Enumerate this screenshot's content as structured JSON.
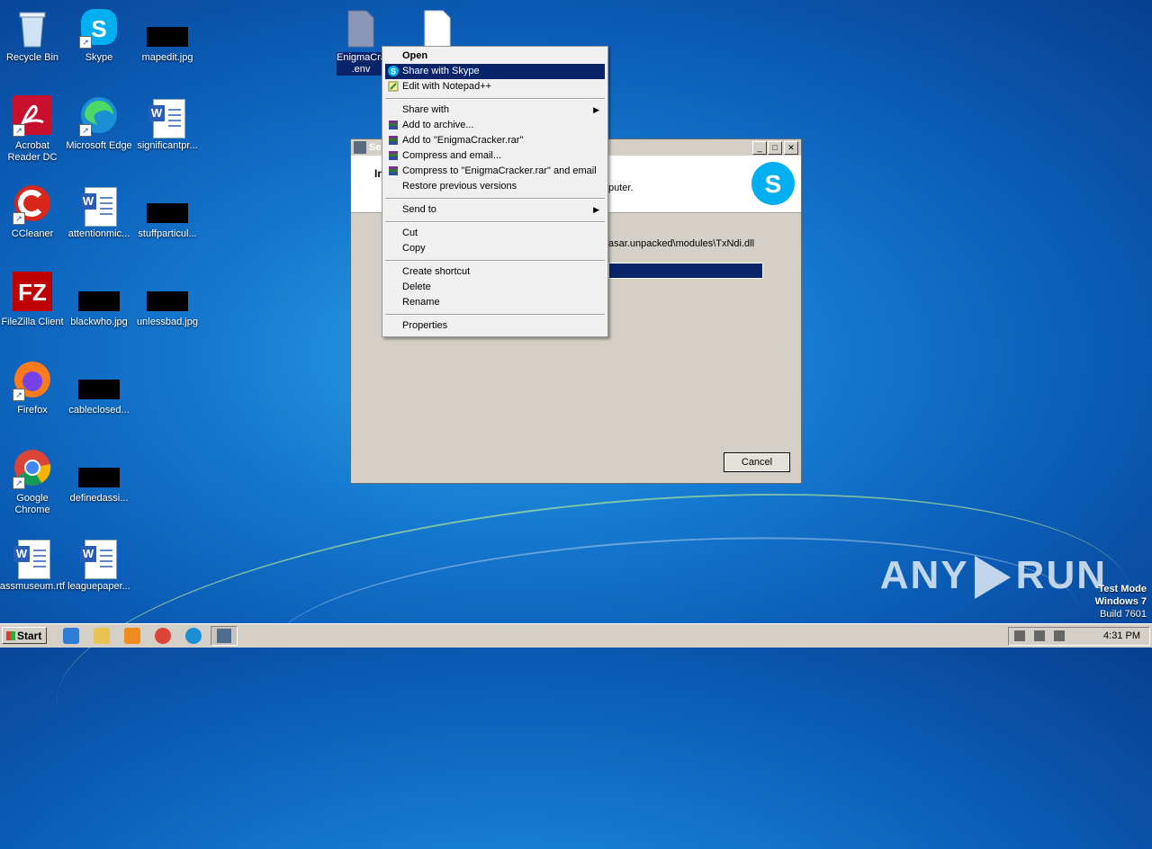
{
  "desktop": {
    "icons": [
      {
        "label": "Recycle Bin"
      },
      {
        "label": "Skype"
      },
      {
        "label": "mapedit.jpg"
      },
      {
        "label": "Acrobat Reader DC"
      },
      {
        "label": "Microsoft Edge"
      },
      {
        "label": "significantpr..."
      },
      {
        "label": "CCleaner"
      },
      {
        "label": "attentionmic..."
      },
      {
        "label": "stuffparticul..."
      },
      {
        "label": "FileZilla Client"
      },
      {
        "label": "blackwho.jpg"
      },
      {
        "label": "unlessbad.jpg"
      },
      {
        "label": "Firefox"
      },
      {
        "label": "cableclosed..."
      },
      {
        "label": "Google Chrome"
      },
      {
        "label": "definedassi..."
      },
      {
        "label": "assmuseum.rtf"
      },
      {
        "label": "leaguepaper..."
      }
    ],
    "selected_file": {
      "label_line1": "EnigmaCra",
      "label_line2": ".env"
    }
  },
  "context_menu": {
    "items": [
      {
        "label": "Open"
      },
      {
        "label": "Share with Skype"
      },
      {
        "label": "Edit with Notepad++"
      },
      {
        "label": "Share with"
      },
      {
        "label": "Add to archive..."
      },
      {
        "label": "Add to \"EnigmaCracker.rar\""
      },
      {
        "label": "Compress and email..."
      },
      {
        "label": "Compress to \"EnigmaCracker.rar\" and email"
      },
      {
        "label": "Restore previous versions"
      },
      {
        "label": "Send to"
      },
      {
        "label": "Cut"
      },
      {
        "label": "Copy"
      },
      {
        "label": "Create shortcut"
      },
      {
        "label": "Delete"
      },
      {
        "label": "Rename"
      },
      {
        "label": "Properties"
      }
    ]
  },
  "dialog": {
    "title_visible": "Se",
    "header_text": "In",
    "header_tail": "puter.",
    "path_text": "asar.unpacked\\modules\\TxNdi.dll",
    "cancel_label": "Cancel"
  },
  "taskbar": {
    "start_label": "Start",
    "clock": "4:31 PM"
  },
  "watermark": {
    "brand_left": "ANY",
    "brand_right": "RUN",
    "mode": "Test Mode",
    "os": "Windows 7",
    "build": "Build 7601"
  },
  "colors": {
    "menu_highlight": "#0a246a",
    "skype_blue": "#00aff0"
  }
}
